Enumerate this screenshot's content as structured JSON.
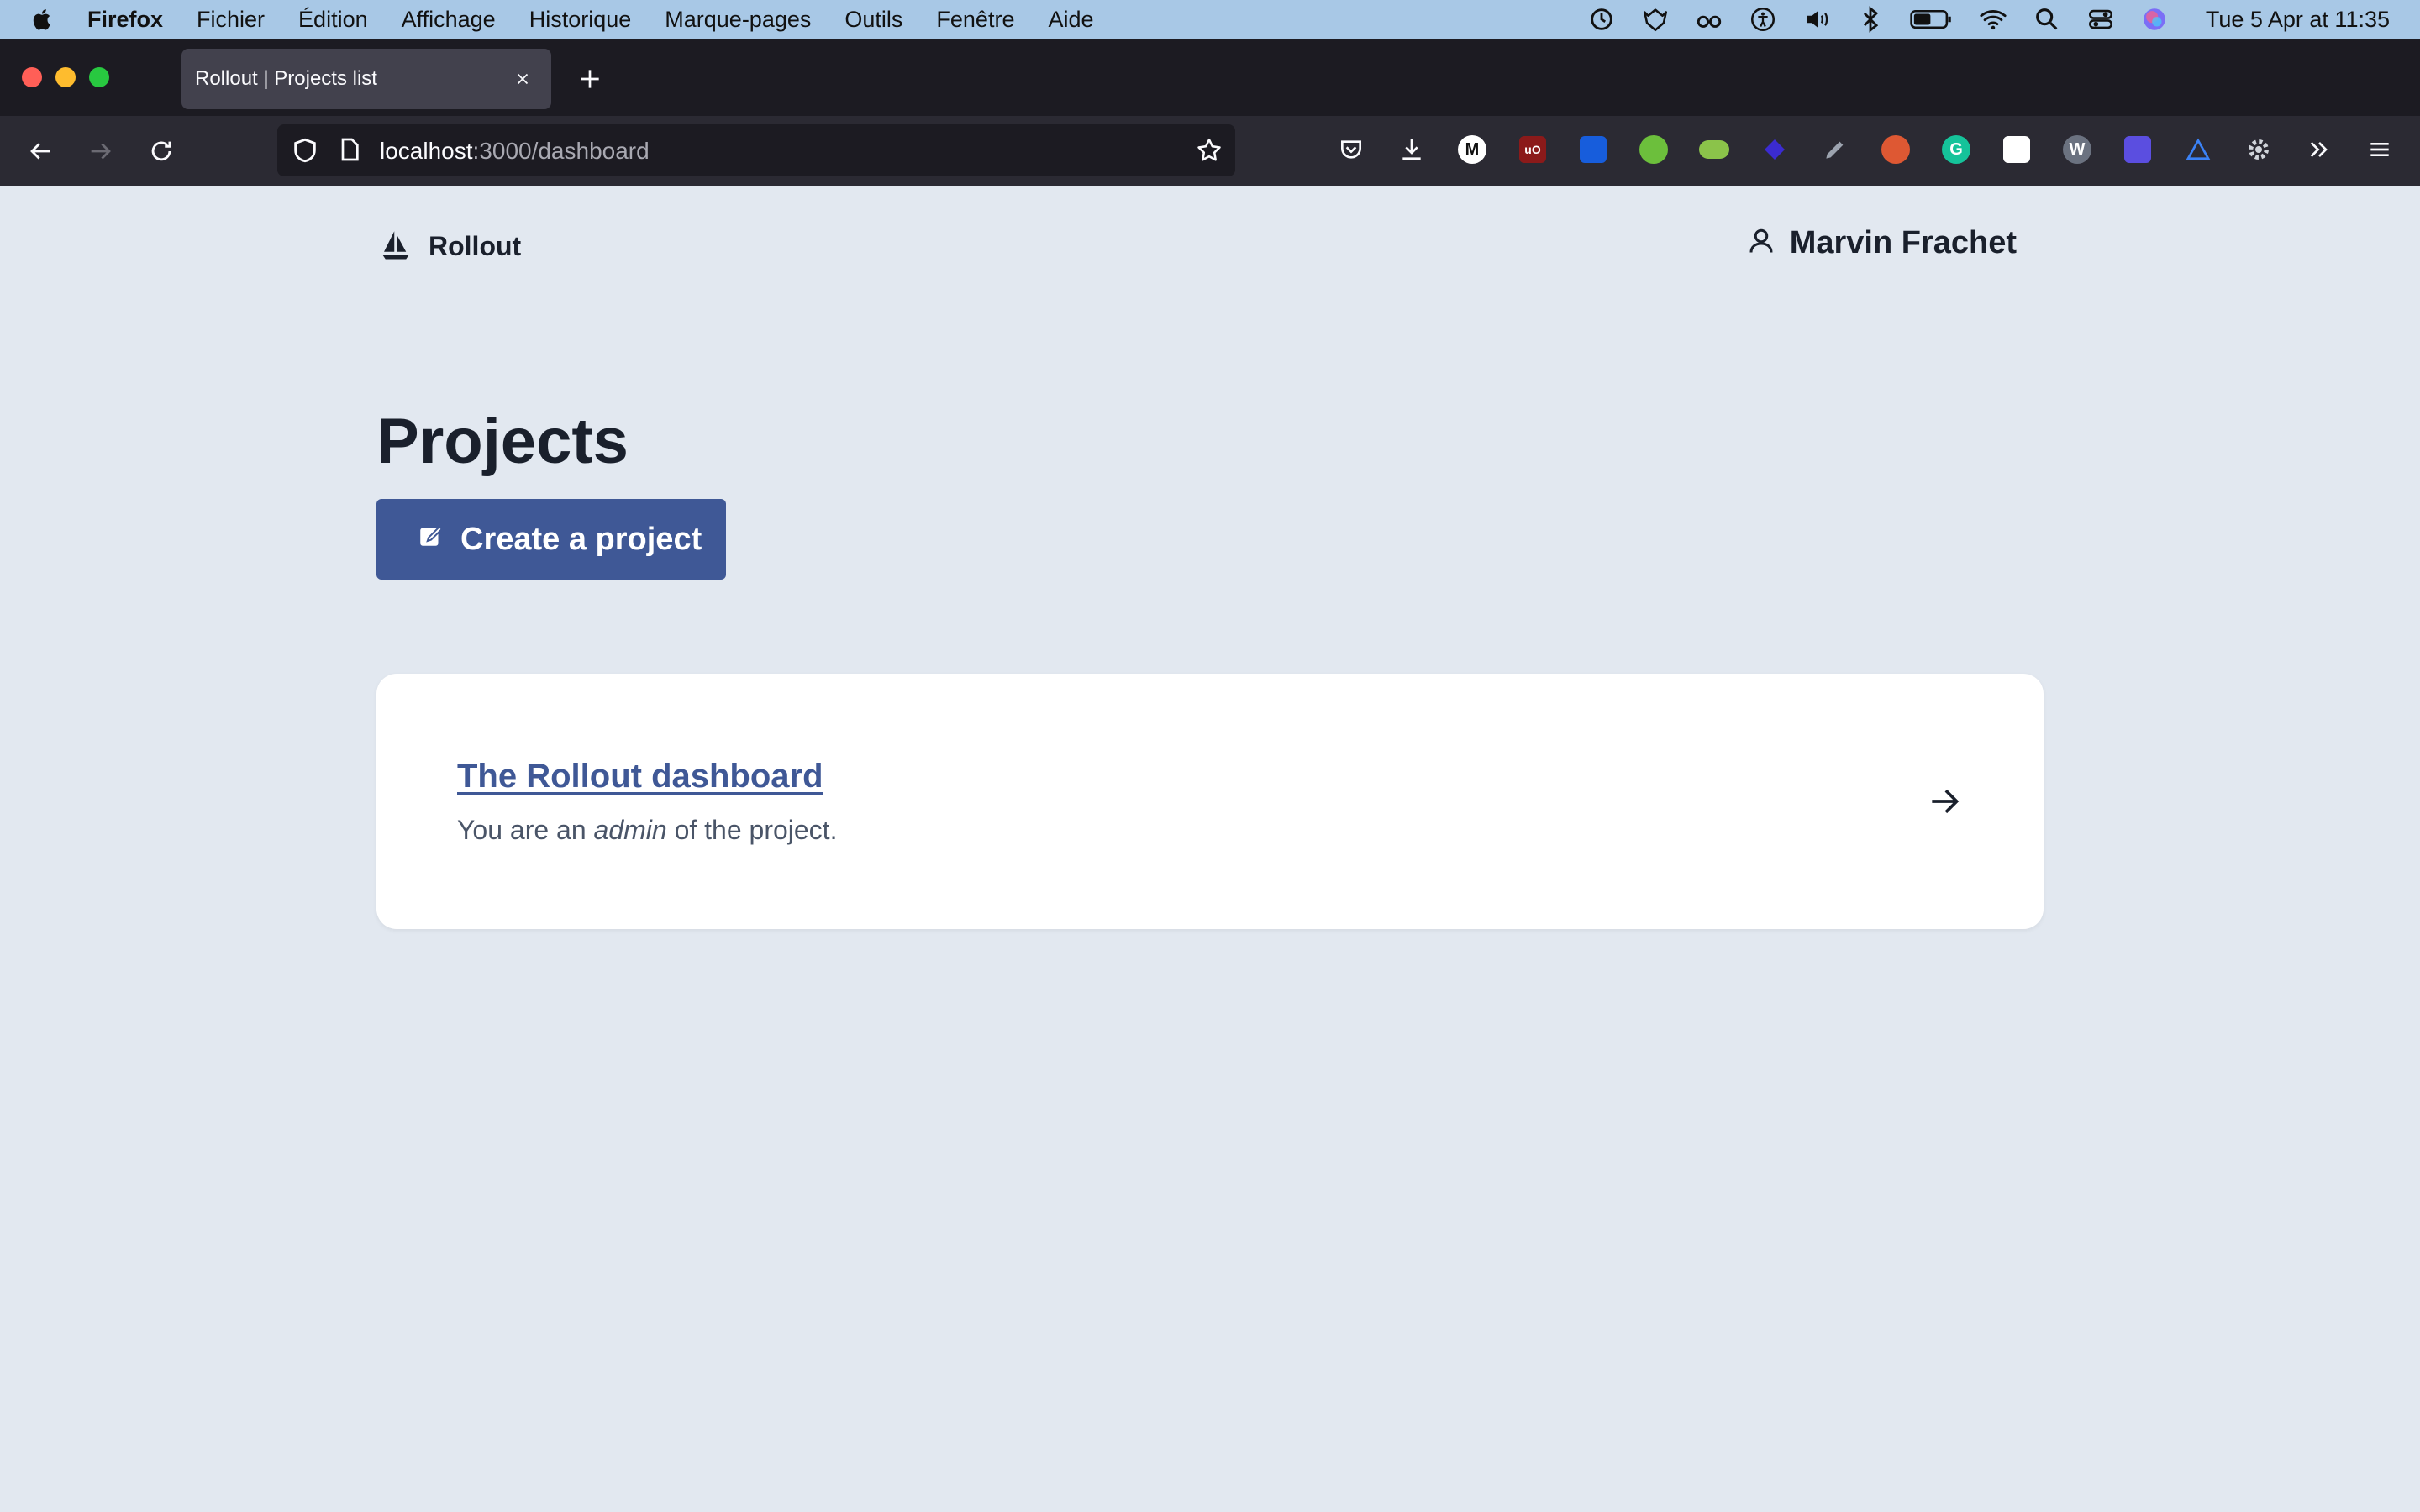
{
  "menubar": {
    "items": [
      "Firefox",
      "Fichier",
      "Édition",
      "Affichage",
      "Historique",
      "Marque-pages",
      "Outils",
      "Fenêtre",
      "Aide"
    ],
    "clock": "Tue 5 Apr at  11:35",
    "status_icons": [
      "time-machine-icon",
      "gitlab-fox-icon",
      "reader-glasses-icon",
      "accessibility-icon",
      "volume-icon",
      "bluetooth-icon",
      "battery-icon",
      "wifi-icon",
      "search-icon",
      "control-center-icon",
      "siri-icon"
    ]
  },
  "browser": {
    "tab_title": "Rollout | Projects list",
    "url_host": "localhost",
    "url_path": ":3000/dashboard",
    "extensions": [
      "pocket-icon",
      "downloads-icon",
      "m-extension-icon",
      "ublock-icon",
      "bitwarden-icon",
      "frog-icon",
      "toggle-extension-icon",
      "layers-icon",
      "pen-icon",
      "duckduckgo-icon",
      "grammarly-icon",
      "qr-icon",
      "w-extension-icon",
      "puzzle-icon",
      "triangle-icon",
      "gear-icon",
      "overflow-icon",
      "hamburger-menu-icon"
    ]
  },
  "header": {
    "brand": "Rollout",
    "user_name": "Marvin Frachet"
  },
  "main": {
    "title": "Projects",
    "create_button": "Create a project",
    "projects": [
      {
        "name": "The Rollout dashboard",
        "desc_prefix": "You are an ",
        "role": "admin",
        "desc_suffix": " of the project."
      }
    ]
  },
  "colors": {
    "page_bg": "#e2e8f0",
    "primary": "#3f5896",
    "card_bg": "#ffffff",
    "text_dark": "#1a202c"
  }
}
